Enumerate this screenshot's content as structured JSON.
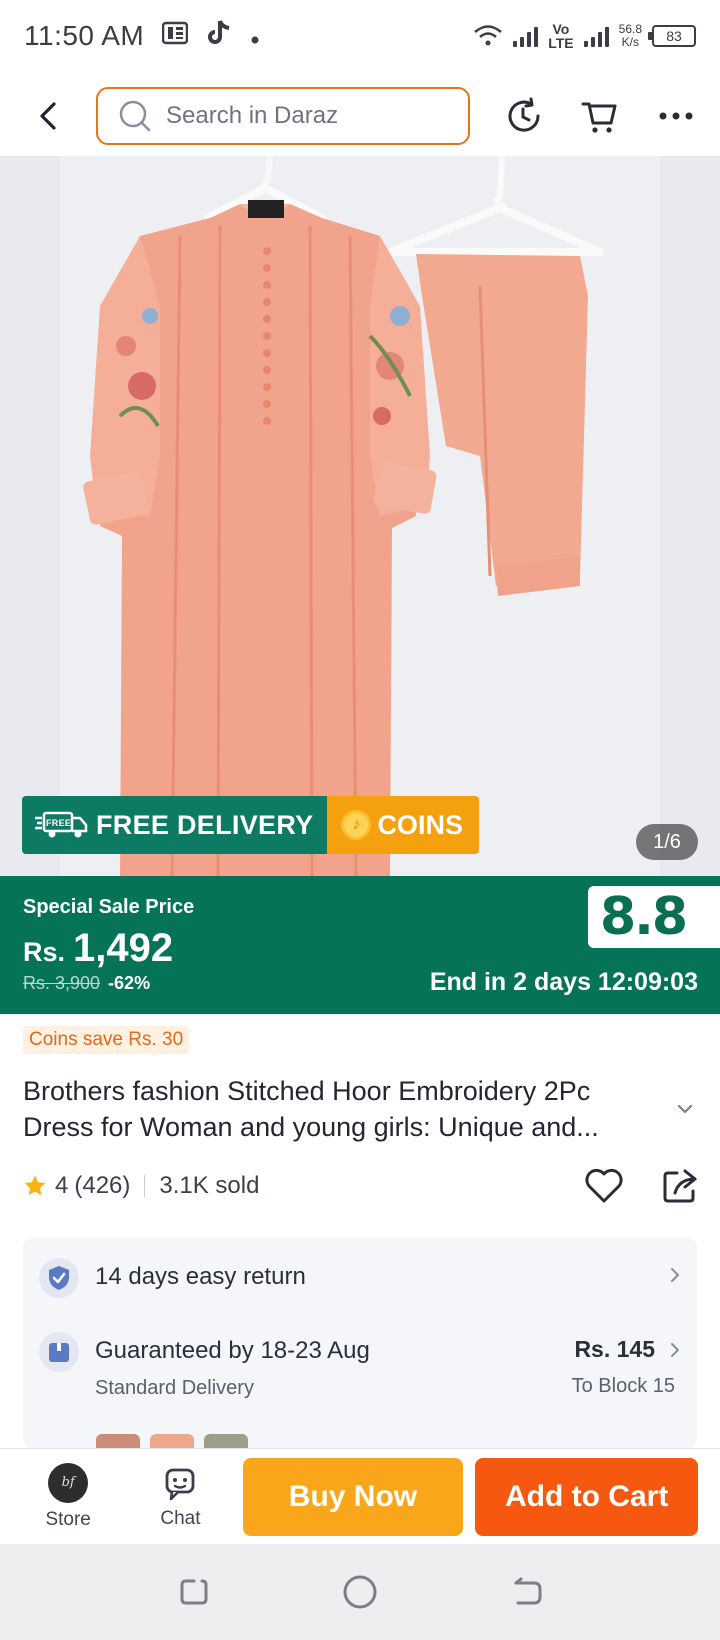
{
  "status_bar": {
    "time": "11:50 AM",
    "network_label": "Vo\nLTE",
    "speed_value": "56.8",
    "speed_unit": "K/s",
    "battery": "83"
  },
  "top_nav": {
    "search_placeholder": "Search in Daraz"
  },
  "product_image": {
    "badge_free": "FREE DELIVERY",
    "badge_free_icon_text": "FREE",
    "badge_coins": "COINS",
    "counter": "1/6"
  },
  "price": {
    "sale_label": "Special Sale Price",
    "currency": "Rs.",
    "amount": "1,492",
    "old_price": "Rs. 3,900",
    "discount": "-62%",
    "event_logo": "8.8",
    "countdown": "End in 2 days 12:09:03"
  },
  "details": {
    "coins_save": "Coins save Rs. 30",
    "title": "Brothers fashion Stitched Hoor Embroidery 2Pc Dress for Woman and young girls: Unique and...",
    "rating": "4",
    "rating_count": "(426)",
    "sold": "3.1K sold"
  },
  "services": {
    "return_label": "14 days easy return",
    "delivery_label": "Guaranteed by 18-23 Aug",
    "delivery_type": "Standard Delivery",
    "delivery_price": "Rs. 145",
    "delivery_location": "To Block 15"
  },
  "bottom_bar": {
    "store_label": "Store",
    "store_avatar_text": "bf",
    "chat_label": "Chat",
    "buy_now": "Buy Now",
    "add_to_cart": "Add to Cart"
  },
  "colors": {
    "brand_orange": "#f7580f",
    "buy_yellow": "#f9a61a",
    "banner_green": "#047357",
    "search_border": "#e6741c"
  }
}
